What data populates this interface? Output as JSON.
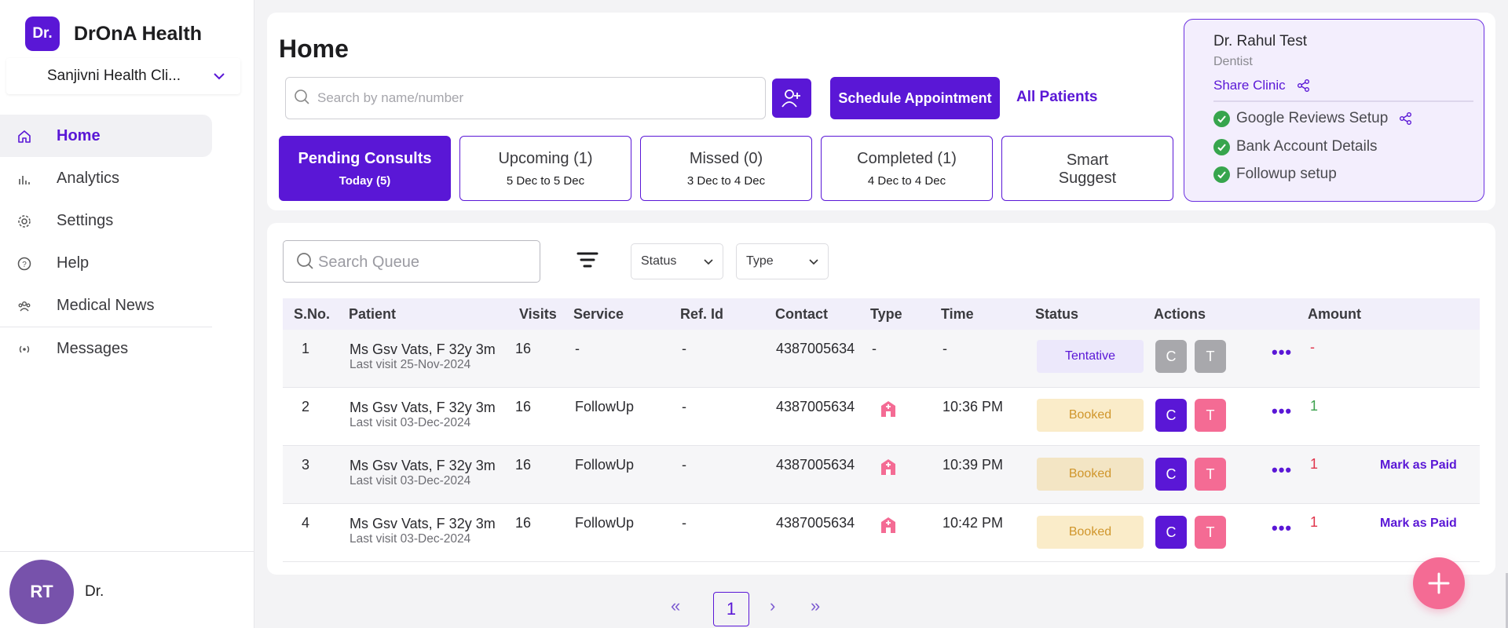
{
  "brand": {
    "logo_text": "Dr.",
    "name": "DrOnA Health"
  },
  "clinic": {
    "selected": "Sanjivni Health Cli..."
  },
  "nav": [
    {
      "label": "Home",
      "icon": "home-icon",
      "active": true
    },
    {
      "label": "Analytics",
      "icon": "analytics-icon"
    },
    {
      "label": "Settings",
      "icon": "settings-icon"
    },
    {
      "label": "Help",
      "icon": "help-icon"
    },
    {
      "label": "Medical News",
      "icon": "news-icon"
    },
    {
      "label": "Messages",
      "icon": "messages-icon"
    }
  ],
  "user": {
    "initials": "RT",
    "name": "Dr."
  },
  "header": {
    "title": "Home",
    "search_placeholder": "Search by name/number",
    "schedule_label": "Schedule Appointment",
    "all_patients_label": "All Patients"
  },
  "tabs": [
    {
      "title": "Pending Consults",
      "sub": "Today (5)",
      "active": true
    },
    {
      "title": "Upcoming (1)",
      "sub": "5 Dec to 5 Dec"
    },
    {
      "title": "Missed (0)",
      "sub": "3 Dec to 4 Dec"
    },
    {
      "title": "Completed (1)",
      "sub": "4 Dec to 4 Dec"
    },
    {
      "title": "Smart Suggest",
      "sub": ""
    }
  ],
  "doctor": {
    "name": "Dr. Rahul Test",
    "role": "Dentist",
    "share_clinic": "Share Clinic",
    "checks": [
      "Google Reviews Setup",
      "Bank Account Details",
      "Followup setup"
    ]
  },
  "queue": {
    "search_placeholder": "Search Queue",
    "status_label": "Status",
    "type_label": "Type",
    "columns": [
      "S.No.",
      "Patient",
      "Visits",
      "Service",
      "Ref. Id",
      "Contact",
      "Type",
      "Time",
      "Status",
      "Actions",
      "Amount"
    ],
    "rows": [
      {
        "sno": "1",
        "patient": "Ms Gsv Vats, F 32y 3m",
        "last_visit": "Last visit 25-Nov-2024",
        "visits": "16",
        "service": "-",
        "ref": "-",
        "contact": "4387005634",
        "type": "-",
        "time": "-",
        "status": "Tentative",
        "c": "C",
        "t": "T",
        "amount": "-",
        "mark": ""
      },
      {
        "sno": "2",
        "patient": "Ms Gsv Vats, F 32y 3m",
        "last_visit": "Last visit 03-Dec-2024",
        "visits": "16",
        "service": "FollowUp",
        "ref": "-",
        "contact": "4387005634",
        "type": "",
        "time": "10:36 PM",
        "status": "Booked",
        "c": "C",
        "t": "T",
        "amount": "1",
        "mark": ""
      },
      {
        "sno": "3",
        "patient": "Ms Gsv Vats, F 32y 3m",
        "last_visit": "Last visit 03-Dec-2024",
        "visits": "16",
        "service": "FollowUp",
        "ref": "-",
        "contact": "4387005634",
        "type": "",
        "time": "10:39 PM",
        "status": "Booked",
        "c": "C",
        "t": "T",
        "amount": "1",
        "mark": "Mark as Paid"
      },
      {
        "sno": "4",
        "patient": "Ms Gsv Vats, F 32y 3m",
        "last_visit": "Last visit 03-Dec-2024",
        "visits": "16",
        "service": "FollowUp",
        "ref": "-",
        "contact": "4387005634",
        "type": "",
        "time": "10:42 PM",
        "status": "Booked",
        "c": "C",
        "t": "T",
        "amount": "1",
        "mark": "Mark as Paid"
      }
    ]
  },
  "pagination": {
    "first": "«",
    "prev": "‹",
    "current": "1",
    "next": "›",
    "last": "»"
  },
  "colors": {
    "primary": "#5a17d6",
    "pink": "#f46b94",
    "success": "#37a54d"
  }
}
